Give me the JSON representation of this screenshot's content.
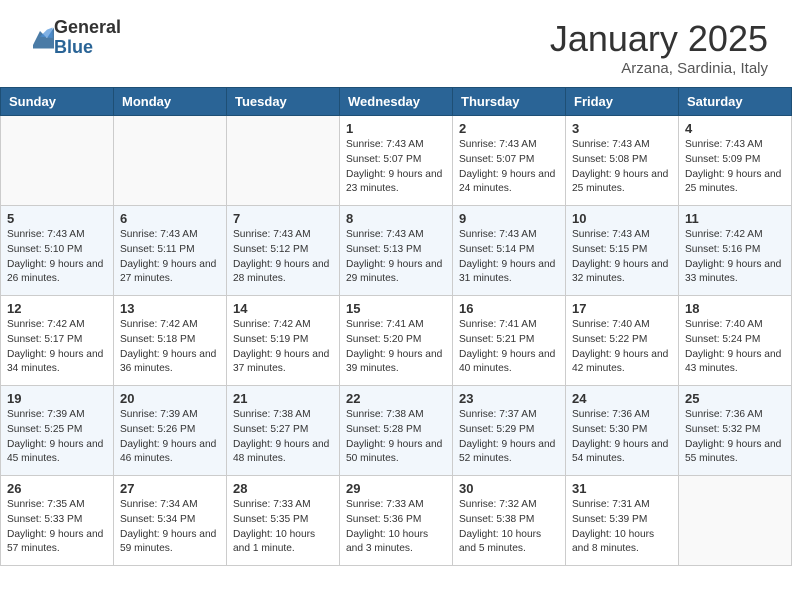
{
  "header": {
    "logo_general": "General",
    "logo_blue": "Blue",
    "title": "January 2025",
    "subtitle": "Arzana, Sardinia, Italy"
  },
  "days_of_week": [
    "Sunday",
    "Monday",
    "Tuesday",
    "Wednesday",
    "Thursday",
    "Friday",
    "Saturday"
  ],
  "weeks": [
    [
      {
        "day": "",
        "info": ""
      },
      {
        "day": "",
        "info": ""
      },
      {
        "day": "",
        "info": ""
      },
      {
        "day": "1",
        "info": "Sunrise: 7:43 AM\nSunset: 5:07 PM\nDaylight: 9 hours and 23 minutes."
      },
      {
        "day": "2",
        "info": "Sunrise: 7:43 AM\nSunset: 5:07 PM\nDaylight: 9 hours and 24 minutes."
      },
      {
        "day": "3",
        "info": "Sunrise: 7:43 AM\nSunset: 5:08 PM\nDaylight: 9 hours and 25 minutes."
      },
      {
        "day": "4",
        "info": "Sunrise: 7:43 AM\nSunset: 5:09 PM\nDaylight: 9 hours and 25 minutes."
      }
    ],
    [
      {
        "day": "5",
        "info": "Sunrise: 7:43 AM\nSunset: 5:10 PM\nDaylight: 9 hours and 26 minutes."
      },
      {
        "day": "6",
        "info": "Sunrise: 7:43 AM\nSunset: 5:11 PM\nDaylight: 9 hours and 27 minutes."
      },
      {
        "day": "7",
        "info": "Sunrise: 7:43 AM\nSunset: 5:12 PM\nDaylight: 9 hours and 28 minutes."
      },
      {
        "day": "8",
        "info": "Sunrise: 7:43 AM\nSunset: 5:13 PM\nDaylight: 9 hours and 29 minutes."
      },
      {
        "day": "9",
        "info": "Sunrise: 7:43 AM\nSunset: 5:14 PM\nDaylight: 9 hours and 31 minutes."
      },
      {
        "day": "10",
        "info": "Sunrise: 7:43 AM\nSunset: 5:15 PM\nDaylight: 9 hours and 32 minutes."
      },
      {
        "day": "11",
        "info": "Sunrise: 7:42 AM\nSunset: 5:16 PM\nDaylight: 9 hours and 33 minutes."
      }
    ],
    [
      {
        "day": "12",
        "info": "Sunrise: 7:42 AM\nSunset: 5:17 PM\nDaylight: 9 hours and 34 minutes."
      },
      {
        "day": "13",
        "info": "Sunrise: 7:42 AM\nSunset: 5:18 PM\nDaylight: 9 hours and 36 minutes."
      },
      {
        "day": "14",
        "info": "Sunrise: 7:42 AM\nSunset: 5:19 PM\nDaylight: 9 hours and 37 minutes."
      },
      {
        "day": "15",
        "info": "Sunrise: 7:41 AM\nSunset: 5:20 PM\nDaylight: 9 hours and 39 minutes."
      },
      {
        "day": "16",
        "info": "Sunrise: 7:41 AM\nSunset: 5:21 PM\nDaylight: 9 hours and 40 minutes."
      },
      {
        "day": "17",
        "info": "Sunrise: 7:40 AM\nSunset: 5:22 PM\nDaylight: 9 hours and 42 minutes."
      },
      {
        "day": "18",
        "info": "Sunrise: 7:40 AM\nSunset: 5:24 PM\nDaylight: 9 hours and 43 minutes."
      }
    ],
    [
      {
        "day": "19",
        "info": "Sunrise: 7:39 AM\nSunset: 5:25 PM\nDaylight: 9 hours and 45 minutes."
      },
      {
        "day": "20",
        "info": "Sunrise: 7:39 AM\nSunset: 5:26 PM\nDaylight: 9 hours and 46 minutes."
      },
      {
        "day": "21",
        "info": "Sunrise: 7:38 AM\nSunset: 5:27 PM\nDaylight: 9 hours and 48 minutes."
      },
      {
        "day": "22",
        "info": "Sunrise: 7:38 AM\nSunset: 5:28 PM\nDaylight: 9 hours and 50 minutes."
      },
      {
        "day": "23",
        "info": "Sunrise: 7:37 AM\nSunset: 5:29 PM\nDaylight: 9 hours and 52 minutes."
      },
      {
        "day": "24",
        "info": "Sunrise: 7:36 AM\nSunset: 5:30 PM\nDaylight: 9 hours and 54 minutes."
      },
      {
        "day": "25",
        "info": "Sunrise: 7:36 AM\nSunset: 5:32 PM\nDaylight: 9 hours and 55 minutes."
      }
    ],
    [
      {
        "day": "26",
        "info": "Sunrise: 7:35 AM\nSunset: 5:33 PM\nDaylight: 9 hours and 57 minutes."
      },
      {
        "day": "27",
        "info": "Sunrise: 7:34 AM\nSunset: 5:34 PM\nDaylight: 9 hours and 59 minutes."
      },
      {
        "day": "28",
        "info": "Sunrise: 7:33 AM\nSunset: 5:35 PM\nDaylight: 10 hours and 1 minute."
      },
      {
        "day": "29",
        "info": "Sunrise: 7:33 AM\nSunset: 5:36 PM\nDaylight: 10 hours and 3 minutes."
      },
      {
        "day": "30",
        "info": "Sunrise: 7:32 AM\nSunset: 5:38 PM\nDaylight: 10 hours and 5 minutes."
      },
      {
        "day": "31",
        "info": "Sunrise: 7:31 AM\nSunset: 5:39 PM\nDaylight: 10 hours and 8 minutes."
      },
      {
        "day": "",
        "info": ""
      }
    ]
  ]
}
